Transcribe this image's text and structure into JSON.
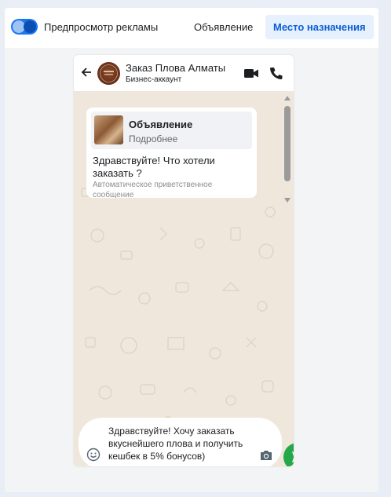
{
  "topbar": {
    "preview_label": "Предпросмотр рекламы",
    "tabs": [
      {
        "label": "Объявление",
        "active": false
      },
      {
        "label": "Место назначения",
        "active": true
      }
    ]
  },
  "chat_header": {
    "name": "Заказ Плова Алматы",
    "subtitle": "Бизнес-аккаунт",
    "icons": [
      "back-arrow-icon",
      "video-call-icon",
      "phone-call-icon",
      "more-vertical-icon"
    ]
  },
  "message": {
    "ad_card": {
      "title": "Объявление",
      "link": "Подробнее"
    },
    "greeting": "Здравствуйте! Что хотели заказать ?",
    "note": "Автоматическое приветственное сообщение"
  },
  "composer": {
    "text": "Здравствуйте! Хочу заказать вкуснейшего плова и получить кешбек в 5% бонусов)",
    "icons": [
      "emoji-icon",
      "camera-icon",
      "send-icon"
    ]
  },
  "colors": {
    "accent": "#1877f2",
    "active_tab_bg": "#e7f0fd",
    "active_tab_text": "#0b5ed7",
    "chat_bg": "#efe7dc",
    "send_green": "#25a84a"
  }
}
